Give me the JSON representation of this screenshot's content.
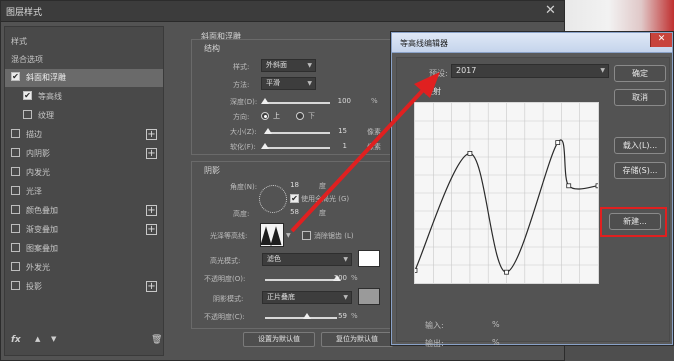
{
  "layer_style": {
    "title": "图层样式",
    "list_header": "样式",
    "blend_options": "混合选项",
    "items": [
      {
        "label": "斜面和浮雕",
        "checked": true,
        "plus": false
      },
      {
        "label": "等高线",
        "checked": true,
        "plus": false
      },
      {
        "label": "纹理",
        "checked": false,
        "plus": false
      },
      {
        "label": "描边",
        "checked": false,
        "plus": true
      },
      {
        "label": "内阴影",
        "checked": false,
        "plus": true
      },
      {
        "label": "内发光",
        "checked": false,
        "plus": false
      },
      {
        "label": "光泽",
        "checked": false,
        "plus": false
      },
      {
        "label": "颜色叠加",
        "checked": false,
        "plus": true
      },
      {
        "label": "渐变叠加",
        "checked": false,
        "plus": true
      },
      {
        "label": "图案叠加",
        "checked": false,
        "plus": false
      },
      {
        "label": "外发光",
        "checked": false,
        "plus": false
      },
      {
        "label": "投影",
        "checked": false,
        "plus": true
      }
    ],
    "footer": {
      "fx": "fx",
      "up": "▲",
      "down": "▼",
      "trash": "🗑"
    }
  },
  "bevel": {
    "section": "斜面和浮雕",
    "structure": "结构",
    "style_label": "样式:",
    "style_value": "外斜面",
    "method_label": "方法:",
    "method_value": "平滑",
    "depth_label": "深度(D):",
    "depth_value": "100",
    "depth_unit": "%",
    "depth_level": 0.0,
    "direction_label": "方向:",
    "dir_up": "上",
    "dir_down": "下",
    "size_label": "大小(Z):",
    "size_value": "15",
    "size_unit": "像素",
    "size_level": 0.05,
    "soften_label": "软化(F):",
    "soften_value": "1",
    "soften_unit": "像素",
    "soften_level": 0.0
  },
  "shading": {
    "section": "阴影",
    "angle_label": "角度(N):",
    "angle_value": "18",
    "angle_unit": "度",
    "global_light": "使用全局光 (G)",
    "altitude_label": "高度:",
    "altitude_value": "58",
    "altitude_unit": "度",
    "gloss_label": "光泽等高线:",
    "antialias": "消除锯齿 (L)",
    "highlight_mode_label": "高光模式:",
    "highlight_mode_value": "滤色",
    "highlight_color": "#ffffff",
    "opacity1_label": "不透明度(O):",
    "opacity1_value": "100",
    "opacity1_unit": "%",
    "opacity1_level": 1.0,
    "shadow_mode_label": "阴影模式:",
    "shadow_mode_value": "正片叠底",
    "shadow_color": "#9a9a9a",
    "opacity2_label": "不透明度(C):",
    "opacity2_value": "59",
    "opacity2_unit": "%",
    "opacity2_level": 0.59,
    "btn_default": "设置为默认值",
    "btn_reset": "复位为默认值"
  },
  "contour_editor": {
    "title": "等高线编辑器",
    "preset_label": "预设:",
    "preset_value": "2017",
    "mapping_label": "映射",
    "input_label": "输入:",
    "input_unit": "%",
    "output_label": "输出:",
    "output_unit": "%",
    "btn_ok": "确定",
    "btn_cancel": "取消",
    "btn_load": "载入(L)...",
    "btn_save": "存储(S)...",
    "btn_new": "新建...",
    "close": "✕",
    "curve_points": [
      [
        0,
        0.07
      ],
      [
        0.3,
        0.72
      ],
      [
        0.5,
        0.06
      ],
      [
        0.78,
        0.78
      ],
      [
        0.84,
        0.54
      ],
      [
        1,
        0.54
      ]
    ],
    "highlight_color": "#e02020"
  }
}
